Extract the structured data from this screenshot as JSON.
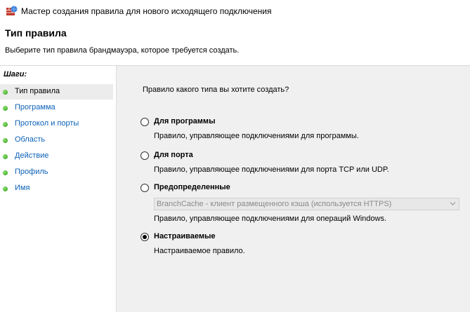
{
  "window": {
    "title": "Мастер создания правила для нового исходящего подключения"
  },
  "header": {
    "title": "Тип правила",
    "subtitle": "Выберите тип правила брандмауэра, которое требуется создать."
  },
  "sidebar": {
    "heading": "Шаги:",
    "steps": [
      {
        "label": "Тип правила",
        "active": true
      },
      {
        "label": "Программа"
      },
      {
        "label": "Протокол и порты"
      },
      {
        "label": "Область"
      },
      {
        "label": "Действие"
      },
      {
        "label": "Профиль"
      },
      {
        "label": "Имя"
      }
    ]
  },
  "main": {
    "question": "Правило какого типа вы хотите создать?",
    "options": [
      {
        "label": "Для программы",
        "description": "Правило, управляющее подключениями для программы.",
        "selected": false
      },
      {
        "label": "Для порта",
        "description": "Правило, управляющее подключениями для порта TCP или UDP.",
        "selected": false
      },
      {
        "label": "Предопределенные",
        "description": "Правило, управляющее подключениями для операций Windows.",
        "selected": false
      },
      {
        "label": "Настраиваемые",
        "description": "Настраиваемое правило.",
        "selected": true
      }
    ],
    "predefined_dropdown": {
      "value": "BranchCache - клиент размещенного кэша (используется HTTPS)",
      "enabled": false
    }
  },
  "colors": {
    "link": "#0b62b8",
    "step_dot": "#3aa82a",
    "panel_bg": "#f0f0f0"
  }
}
